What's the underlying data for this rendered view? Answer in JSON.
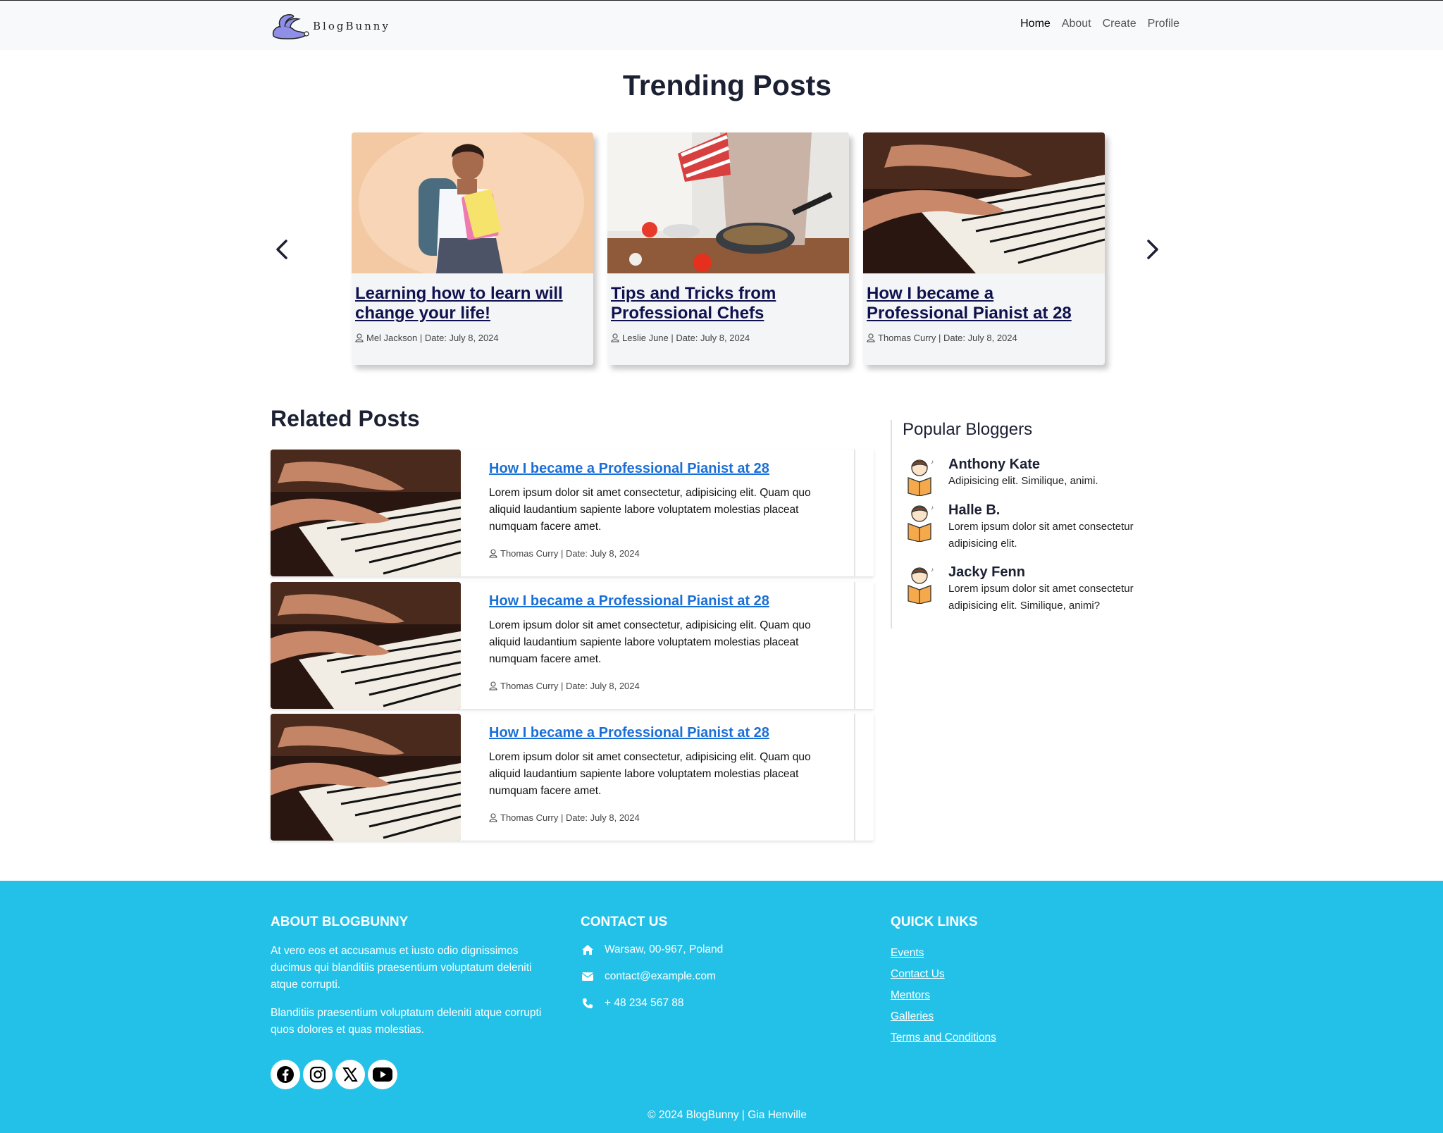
{
  "nav": {
    "brand": "BlogBunny",
    "links": [
      "Home",
      "About",
      "Create",
      "Profile"
    ]
  },
  "trending": {
    "title": "Trending Posts",
    "cards": [
      {
        "title": "Learning how to learn will change your life!",
        "meta": "Mel Jackson | Date: July 8, 2024"
      },
      {
        "title": "Tips and Tricks from Professional Chefs",
        "meta": "Leslie June | Date: July 8, 2024"
      },
      {
        "title": "How I became a Professional Pianist at 28",
        "meta": "Thomas Curry | Date: July 8, 2024"
      }
    ]
  },
  "related": {
    "title": "Related Posts",
    "posts": [
      {
        "title": "How I became a Professional Pianist at 28",
        "desc": "Lorem ipsum dolor sit amet consectetur, adipisicing elit. Quam quo aliquid laudantium sapiente labore voluptatem molestias placeat numquam facere amet.",
        "meta": "Thomas Curry | Date: July 8, 2024"
      },
      {
        "title": "How I became a Professional Pianist at 28",
        "desc": "Lorem ipsum dolor sit amet consectetur, adipisicing elit. Quam quo aliquid laudantium sapiente labore voluptatem molestias placeat numquam facere amet.",
        "meta": "Thomas Curry | Date: July 8, 2024"
      },
      {
        "title": "How I became a Professional Pianist at 28",
        "desc": "Lorem ipsum dolor sit amet consectetur, adipisicing elit. Quam quo aliquid laudantium sapiente labore voluptatem molestias placeat numquam facere amet.",
        "meta": "Thomas Curry | Date: July 8, 2024"
      }
    ]
  },
  "popular": {
    "title": "Popular Bloggers",
    "bloggers": [
      {
        "name": "Anthony Kate",
        "desc": "Adipisicing elit. Similique, animi."
      },
      {
        "name": "Halle B.",
        "desc": "Lorem ipsum dolor sit amet consectetur adipisicing elit."
      },
      {
        "name": "Jacky Fenn",
        "desc": "Lorem ipsum dolor sit amet consectetur adipisicing elit. Similique, animi?"
      }
    ]
  },
  "footer": {
    "about_title": "About BlogBunny",
    "about_p1": "At vero eos et accusamus et iusto odio dignissimos ducimus qui blanditiis praesentium voluptatum deleniti atque corrupti.",
    "about_p2": "Blanditiis praesentium voluptatum deleniti atque corrupti quos dolores et quas molestias.",
    "contact_title": "Contact Us",
    "address": "Warsaw, 00-967, Poland",
    "email": "contact@example.com",
    "phone": "+ 48 234 567 88",
    "links_title": "Quick Links",
    "links": [
      "Events",
      "Contact Us",
      "Mentors",
      "Galleries",
      "Terms and Conditions"
    ],
    "copyright": "© 2024 BlogBunny | Gia Henville",
    "social_icons": [
      "facebook-icon",
      "instagram-icon",
      "x-icon",
      "youtube-icon"
    ]
  },
  "colors": {
    "footer_bg": "#23c1e8",
    "trending_link": "#10124f",
    "related_link": "#1a6fd6",
    "nav_bg": "#f8f9fa"
  }
}
